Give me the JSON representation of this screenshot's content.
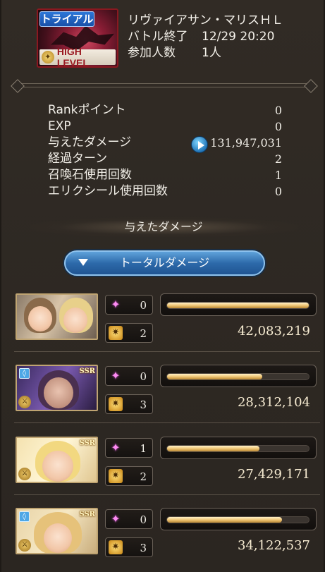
{
  "header": {
    "trial_label": "トライアル",
    "level_label": "HIGH LEVEL",
    "quest_name": "リヴァイアサン・マリスＨＬ",
    "battle_end_label": "バトル終了",
    "battle_end_time": "12/29 20:20",
    "participants_label": "参加人数",
    "participants_value": "1人"
  },
  "stats": [
    {
      "label": "Rankポイント",
      "value": "0"
    },
    {
      "label": "EXP",
      "value": "0"
    },
    {
      "label": "与えたダメージ",
      "value": "131,947,031"
    },
    {
      "label": "経過ターン",
      "value": "2"
    },
    {
      "label": "召喚石使用回数",
      "value": "1"
    },
    {
      "label": "エリクシール使用回数",
      "value": "0"
    }
  ],
  "section_title": "与えたダメージ",
  "total_button": "トータルダメージ",
  "characters": [
    {
      "ability_count": "0",
      "ougi_count": "2",
      "damage": "42,083,219",
      "bar_fraction": 1.0
    },
    {
      "ability_count": "0",
      "ougi_count": "3",
      "damage": "28,312,104",
      "bar_fraction": 0.67,
      "rarity": "SSR"
    },
    {
      "ability_count": "1",
      "ougi_count": "2",
      "damage": "27,429,171",
      "bar_fraction": 0.65,
      "rarity": "SSR"
    },
    {
      "ability_count": "0",
      "ougi_count": "3",
      "damage": "34,122,537",
      "bar_fraction": 0.81,
      "rarity": "SSR"
    }
  ],
  "colors": {
    "background": "#2f2a25",
    "bar_fill": "#f0c777",
    "button_blue": "#2d6aaa",
    "ability_star": "#ff8cf4"
  }
}
